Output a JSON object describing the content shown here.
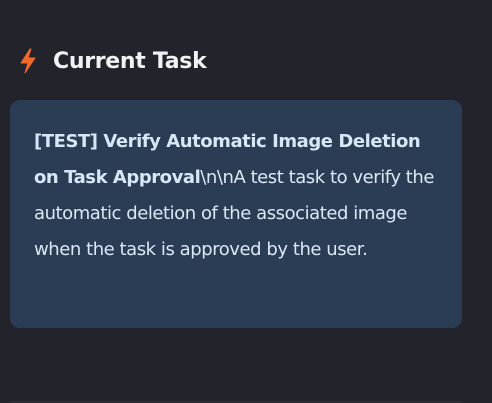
{
  "header": {
    "icon": "lightning-bolt-icon",
    "icon_color": "#f0692b",
    "title": "Current Task"
  },
  "task": {
    "title": "[TEST] Verify Automatic Image Deletion on Task Approval",
    "description": "\\n\\nA test task to verify the automatic deletion of the associated image when the task is approved by the user."
  },
  "colors": {
    "background": "#23232b",
    "card_background": "#2b3d55",
    "card_text": "#dbe8f7"
  }
}
